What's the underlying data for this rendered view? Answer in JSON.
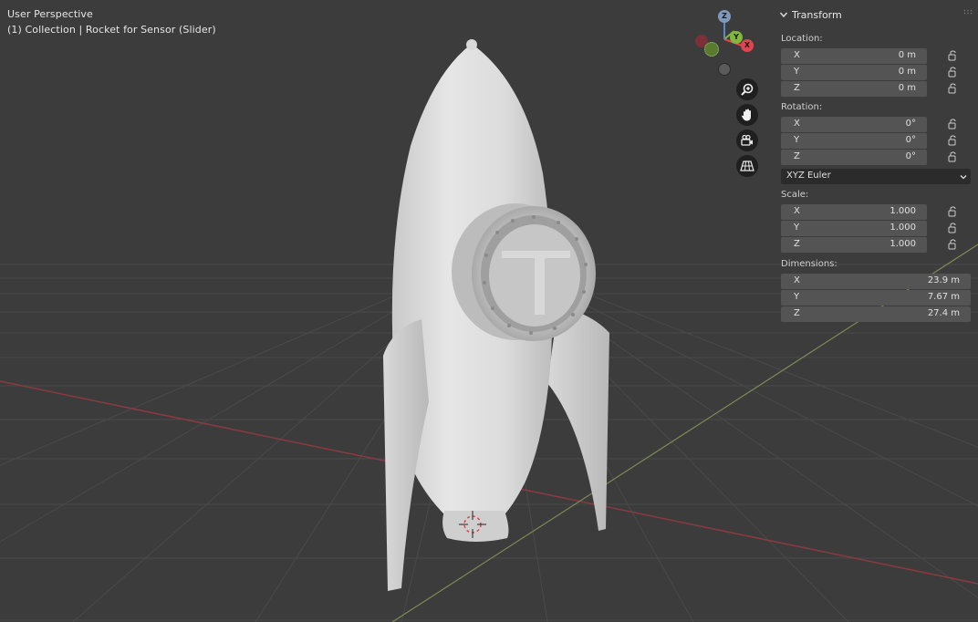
{
  "viewport": {
    "view_name": "User Perspective",
    "collection_info": "(1) Collection | Rocket for Sensor (Slider)"
  },
  "gizmo": {
    "axis_x": "X",
    "axis_y": "Y",
    "axis_z": "Z",
    "colors": {
      "x": "#e2444f",
      "y": "#7fb83c",
      "z": "#5d86c6"
    }
  },
  "nav_buttons": [
    "zoom-icon",
    "hand-icon",
    "camera-icon",
    "grid-icon"
  ],
  "transform": {
    "title": "Transform",
    "location": {
      "label": "Location:",
      "x": {
        "axis": "X",
        "value": "0 m"
      },
      "y": {
        "axis": "Y",
        "value": "0 m"
      },
      "z": {
        "axis": "Z",
        "value": "0 m"
      }
    },
    "rotation": {
      "label": "Rotation:",
      "x": {
        "axis": "X",
        "value": "0°"
      },
      "y": {
        "axis": "Y",
        "value": "0°"
      },
      "z": {
        "axis": "Z",
        "value": "0°"
      },
      "mode": "XYZ Euler"
    },
    "scale": {
      "label": "Scale:",
      "x": {
        "axis": "X",
        "value": "1.000"
      },
      "y": {
        "axis": "Y",
        "value": "1.000"
      },
      "z": {
        "axis": "Z",
        "value": "1.000"
      }
    },
    "dimensions": {
      "label": "Dimensions:",
      "x": {
        "axis": "X",
        "value": "23.9 m"
      },
      "y": {
        "axis": "Y",
        "value": "7.67 m"
      },
      "z": {
        "axis": "Z",
        "value": "27.4 m"
      }
    }
  }
}
